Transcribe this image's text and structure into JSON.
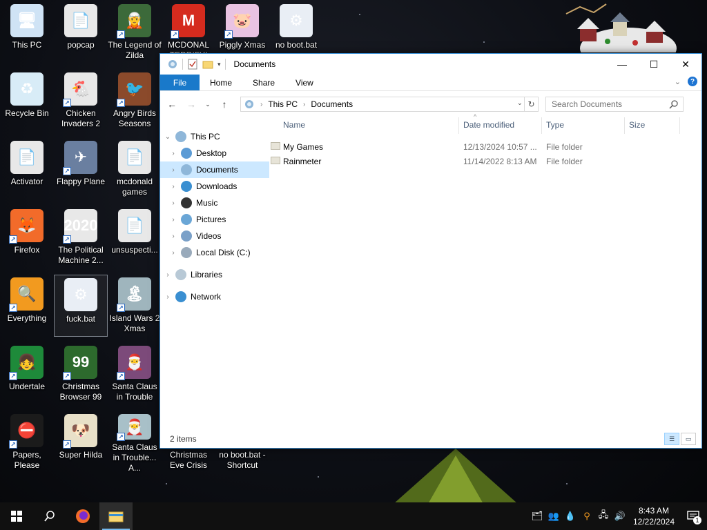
{
  "desktop": {
    "icons": [
      {
        "label": "This PC",
        "glyph": "🖥",
        "bg": "#cfe3f5",
        "shortcut": false
      },
      {
        "label": "popcap",
        "glyph": "📄",
        "bg": "#e8e8e8",
        "shortcut": false
      },
      {
        "label": "The Legend of Zilda",
        "glyph": "🧝",
        "bg": "#3c6a3a",
        "shortcut": true
      },
      {
        "label": "MCDONAL TERRIFYI",
        "glyph": "M",
        "bg": "#d52b1e",
        "shortcut": true
      },
      {
        "label": "Piggly Xmas",
        "glyph": "🐷",
        "bg": "#e9c3e2",
        "shortcut": true
      },
      {
        "label": "no boot.bat",
        "glyph": "⚙",
        "bg": "#e9eef5",
        "shortcut": false
      },
      {
        "label": "Recycle Bin",
        "glyph": "♻",
        "bg": "#d8ecf7",
        "shortcut": false
      },
      {
        "label": "Chicken Invaders 2",
        "glyph": "🐔",
        "bg": "#e8e8e8",
        "shortcut": true
      },
      {
        "label": "Angry Birds Seasons",
        "glyph": "🐦",
        "bg": "#8b4a2b",
        "shortcut": true
      },
      {
        "label": "Activator",
        "glyph": "📄",
        "bg": "#e8e8e8",
        "shortcut": false
      },
      {
        "label": "Flappy Plane",
        "glyph": "✈",
        "bg": "#6a7fa0",
        "shortcut": true
      },
      {
        "label": "mcdonald games",
        "glyph": "📄",
        "bg": "#e8e8e8",
        "shortcut": false
      },
      {
        "label": "Firefox",
        "glyph": "🦊",
        "bg": "#f26b2a",
        "shortcut": true
      },
      {
        "label": "The Political Machine 2...",
        "glyph": "2020",
        "bg": "#e8e8e8",
        "shortcut": true
      },
      {
        "label": "unsuspecti...",
        "glyph": "📄",
        "bg": "#e8e8e8",
        "shortcut": false
      },
      {
        "label": "Everything",
        "glyph": "🔍",
        "bg": "#f29a1f",
        "shortcut": true
      },
      {
        "label": "fuck.bat",
        "glyph": "⚙",
        "bg": "#e9eef5",
        "shortcut": false
      },
      {
        "label": "Island Wars 2 Xmas",
        "glyph": "🏝",
        "bg": "#9fb5bd",
        "shortcut": true
      },
      {
        "label": "Undertale",
        "glyph": "👧",
        "bg": "#1e8a3a",
        "shortcut": true
      },
      {
        "label": "Christmas Browser 99",
        "glyph": "99",
        "bg": "#2d6a2d",
        "shortcut": true
      },
      {
        "label": "Santa Claus in Trouble",
        "glyph": "🎅",
        "bg": "#7c4a7a",
        "shortcut": true
      },
      {
        "label": "Papers, Please",
        "glyph": "⛔",
        "bg": "#1b1b1b",
        "shortcut": true
      },
      {
        "label": "Super Hilda",
        "glyph": "🐶",
        "bg": "#e8e0c8",
        "shortcut": true
      },
      {
        "label": "Santa Claus in Trouble... A...",
        "glyph": "🎅",
        "bg": "#a8c0c8",
        "shortcut": true
      },
      {
        "label": "Christmas Eve Crisis",
        "glyph": "",
        "bg": "transparent",
        "shortcut": false
      },
      {
        "label": "no boot.bat - Shortcut",
        "glyph": "",
        "bg": "transparent",
        "shortcut": false
      }
    ]
  },
  "explorer": {
    "title": "Documents",
    "window_buttons": {
      "minimize": "—",
      "maximize": "☐",
      "close": "✕"
    },
    "ribbon_tabs": [
      "File",
      "Home",
      "Share",
      "View"
    ],
    "address": {
      "root": "This PC",
      "current": "Documents",
      "separator": "›"
    },
    "search_placeholder": "Search Documents",
    "nav": {
      "this_pc": "This PC",
      "items": [
        "Desktop",
        "Documents",
        "Downloads",
        "Music",
        "Pictures",
        "Videos",
        "Local Disk (C:)"
      ],
      "selected": "Documents",
      "libraries": "Libraries",
      "network": "Network"
    },
    "columns": {
      "name": "Name",
      "date": "Date modified",
      "type": "Type",
      "size": "Size"
    },
    "files": [
      {
        "name": "My Games",
        "date": "12/13/2024 10:57 ...",
        "type": "File folder",
        "size": ""
      },
      {
        "name": "Rainmeter",
        "date": "11/14/2022 8:13 AM",
        "type": "File folder",
        "size": ""
      }
    ],
    "status": "2 items"
  },
  "taskbar": {
    "clock_time": "8:43 AM",
    "clock_date": "12/22/2024",
    "notification_count": "1"
  },
  "colors": {
    "file_tab": "#1979ca",
    "selection": "#cce8ff",
    "taskbar": "#101010",
    "window_border": "#3b8fd4"
  }
}
